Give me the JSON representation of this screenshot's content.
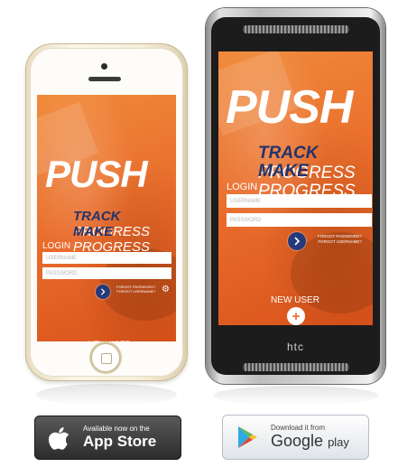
{
  "app": {
    "logo": "PUSH",
    "tagline": {
      "line1_bold": "TRACK",
      "line1_thin": "PROGRESS",
      "line2_bold": "MAKE",
      "line2_thin": "PROGRESS"
    },
    "login_label": "LOGIN",
    "username_placeholder": "USERNAME",
    "password_placeholder": "PASSWORD",
    "forgot_password": "FORGOT PASSWORD?",
    "forgot_username": "FORGOT USERNAME?",
    "new_user_label": "NEW USER",
    "colors": {
      "background": "#e8692a",
      "accent": "#23336b"
    }
  },
  "devices": {
    "android_brand": "htc"
  },
  "badges": {
    "apple": {
      "small": "Available now on the",
      "big": "App Store"
    },
    "google": {
      "small": "Download it from",
      "big": "Google",
      "play": "play"
    }
  },
  "icons": [
    "apple-icon",
    "google-play-icon",
    "arrow-right-icon",
    "plus-icon",
    "gear-icon"
  ]
}
